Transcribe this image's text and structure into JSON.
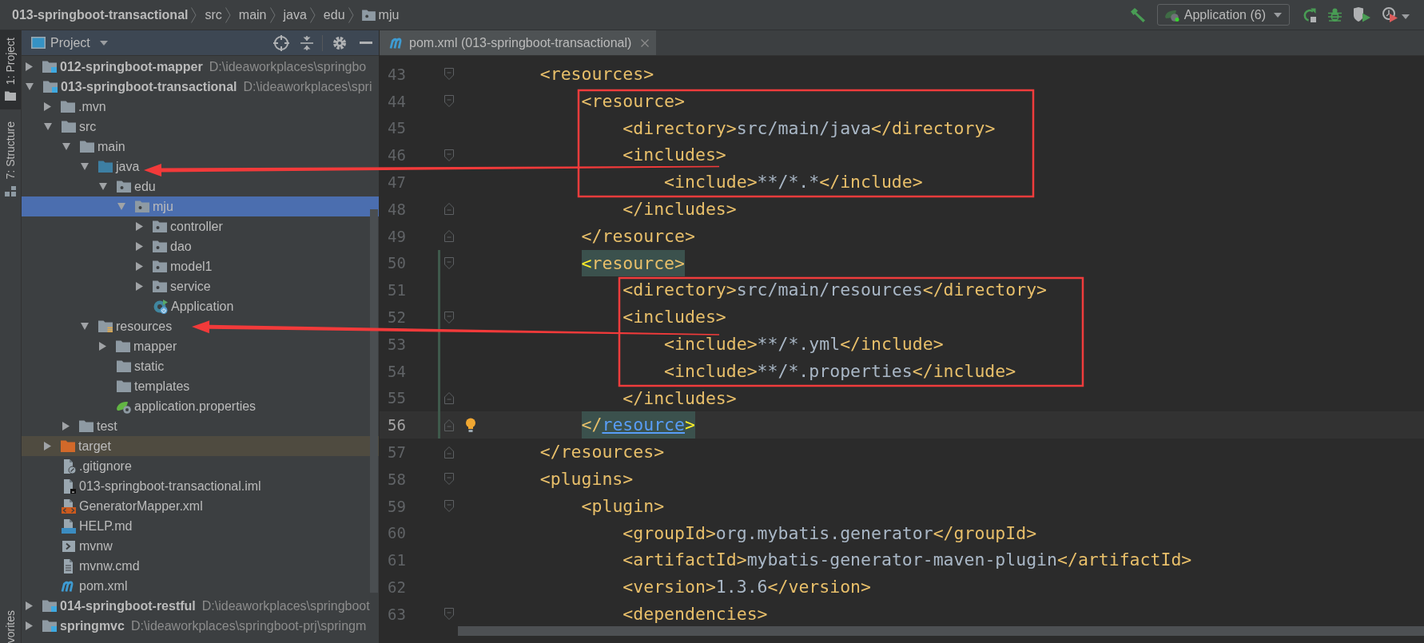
{
  "breadcrumbs": [
    {
      "label": "013-springboot-transactional",
      "kind": "module"
    },
    {
      "label": "src",
      "kind": "folder"
    },
    {
      "label": "main",
      "kind": "folder"
    },
    {
      "label": "java",
      "kind": "folder"
    },
    {
      "label": "edu",
      "kind": "folder"
    },
    {
      "label": "mju",
      "kind": "package"
    }
  ],
  "toolbar": {
    "run_config": "Application (6)"
  },
  "tool_strip": [
    {
      "label": "1: Project",
      "kind": "project",
      "selected": true
    },
    {
      "label": "7: Structure",
      "kind": "structure",
      "selected": false
    },
    {
      "label": "vorites",
      "kind": "favorites",
      "selected": false
    }
  ],
  "project_panel": {
    "title": "Project",
    "tree": [
      {
        "label": "012-springboot-mapper",
        "path": "D:\\ideaworkplaces\\springbo",
        "kind": "module",
        "expandable": true,
        "expanded": false,
        "selected": false
      },
      {
        "label": "013-springboot-transactional",
        "path": "D:\\ideaworkplaces\\spri",
        "kind": "module",
        "expandable": true,
        "expanded": true,
        "selected": false,
        "children": [
          {
            "label": ".mvn",
            "kind": "folder",
            "expandable": true,
            "expanded": false,
            "selected": false
          },
          {
            "label": "src",
            "kind": "folder",
            "expandable": true,
            "expanded": true,
            "selected": false,
            "children": [
              {
                "label": "main",
                "kind": "folder",
                "expandable": true,
                "expanded": true,
                "selected": false,
                "children": [
                  {
                    "label": "java",
                    "kind": "source-root",
                    "expandable": true,
                    "expanded": true,
                    "selected": false,
                    "children": [
                      {
                        "label": "edu",
                        "kind": "package",
                        "expandable": true,
                        "expanded": true,
                        "selected": false,
                        "children": [
                          {
                            "label": "mju",
                            "kind": "package",
                            "expandable": true,
                            "expanded": true,
                            "selected": true,
                            "children": [
                              {
                                "label": "controller",
                                "kind": "package",
                                "expandable": true,
                                "expanded": false,
                                "selected": false
                              },
                              {
                                "label": "dao",
                                "kind": "package",
                                "expandable": true,
                                "expanded": false,
                                "selected": false
                              },
                              {
                                "label": "model1",
                                "kind": "package",
                                "expandable": true,
                                "expanded": false,
                                "selected": false
                              },
                              {
                                "label": "service",
                                "kind": "package",
                                "expandable": true,
                                "expanded": false,
                                "selected": false
                              },
                              {
                                "label": "Application",
                                "kind": "spring-class",
                                "expandable": false,
                                "selected": false
                              }
                            ]
                          }
                        ]
                      }
                    ]
                  },
                  {
                    "label": "resources",
                    "kind": "resources-root",
                    "expandable": true,
                    "expanded": true,
                    "selected": false,
                    "children": [
                      {
                        "label": "mapper",
                        "kind": "folder",
                        "expandable": true,
                        "expanded": false,
                        "selected": false
                      },
                      {
                        "label": "static",
                        "kind": "folder",
                        "expandable": false,
                        "selected": false
                      },
                      {
                        "label": "templates",
                        "kind": "folder",
                        "expandable": false,
                        "selected": false
                      },
                      {
                        "label": "application.properties",
                        "kind": "spring-config",
                        "expandable": false,
                        "selected": false
                      }
                    ]
                  }
                ]
              },
              {
                "label": "test",
                "kind": "folder",
                "expandable": true,
                "expanded": false,
                "selected": false
              }
            ]
          },
          {
            "label": "target",
            "kind": "excluded",
            "expandable": true,
            "expanded": false,
            "selected": false
          },
          {
            "label": ".gitignore",
            "kind": "ignore-file",
            "expandable": false,
            "selected": false
          },
          {
            "label": "013-springboot-transactional.iml",
            "kind": "module-file",
            "expandable": false,
            "selected": false
          },
          {
            "label": "GeneratorMapper.xml",
            "kind": "xml-file",
            "expandable": false,
            "selected": false
          },
          {
            "label": "HELP.md",
            "kind": "markdown-file",
            "expandable": false,
            "selected": false
          },
          {
            "label": "mvnw",
            "kind": "shell-file",
            "expandable": false,
            "selected": false
          },
          {
            "label": "mvnw.cmd",
            "kind": "text-file",
            "expandable": false,
            "selected": false
          },
          {
            "label": "pom.xml",
            "kind": "maven-file",
            "expandable": false,
            "selected": false
          }
        ]
      },
      {
        "label": "014-springboot-restful",
        "path": "D:\\ideaworkplaces\\springboot",
        "kind": "module",
        "expandable": true,
        "expanded": false,
        "selected": false
      },
      {
        "label": "springmvc",
        "path": "D:\\ideaworkplaces\\springboot-prj\\springm",
        "kind": "module",
        "expandable": true,
        "expanded": false,
        "selected": false
      }
    ]
  },
  "editor": {
    "tabs": [
      {
        "label": "pom.xml (013-springboot-transactional)",
        "selected": true
      }
    ],
    "lines": [
      {
        "number": "43",
        "tokens": [
          {
            "kind": "tag",
            "text": "<resources>"
          }
        ],
        "fold_start": true,
        "fold_end": false,
        "current": false,
        "changed": false,
        "matched": false
      },
      {
        "number": "44",
        "tokens": [
          {
            "kind": "tag",
            "text": "<resource>"
          }
        ],
        "fold_start": true,
        "fold_end": false,
        "current": false,
        "changed": false,
        "matched": false
      },
      {
        "number": "45",
        "tokens": [
          {
            "kind": "tag",
            "text": "<directory>"
          },
          {
            "kind": "text",
            "text": "src/main/java"
          },
          {
            "kind": "tag",
            "text": "</directory>"
          }
        ],
        "fold_start": false,
        "fold_end": false,
        "current": false,
        "changed": false,
        "matched": false
      },
      {
        "number": "46",
        "tokens": [
          {
            "kind": "tag",
            "text": "<includes>"
          }
        ],
        "fold_start": true,
        "fold_end": false,
        "current": false,
        "changed": false,
        "matched": false
      },
      {
        "number": "47",
        "tokens": [
          {
            "kind": "tag",
            "text": "<include>"
          },
          {
            "kind": "text",
            "text": "**/*.*"
          },
          {
            "kind": "tag",
            "text": "</include>"
          }
        ],
        "fold_start": false,
        "fold_end": false,
        "current": false,
        "changed": false,
        "matched": false
      },
      {
        "number": "48",
        "tokens": [
          {
            "kind": "tag",
            "text": "</includes>"
          }
        ],
        "fold_start": false,
        "fold_end": true,
        "current": false,
        "changed": false,
        "matched": false
      },
      {
        "number": "49",
        "tokens": [
          {
            "kind": "tag",
            "text": "</resource>"
          }
        ],
        "fold_start": false,
        "fold_end": true,
        "current": false,
        "changed": false,
        "matched": false
      },
      {
        "number": "50",
        "tokens": [
          {
            "kind": "brace",
            "text": "<"
          },
          {
            "kind": "tag",
            "text": "resource>"
          }
        ],
        "fold_start": true,
        "fold_end": false,
        "current": false,
        "changed": true,
        "matched": true
      },
      {
        "number": "51",
        "tokens": [
          {
            "kind": "tag",
            "text": "<directory>"
          },
          {
            "kind": "text",
            "text": "src/main/resources"
          },
          {
            "kind": "tag",
            "text": "</directory>"
          }
        ],
        "fold_start": false,
        "fold_end": false,
        "current": false,
        "changed": true,
        "matched": false
      },
      {
        "number": "52",
        "tokens": [
          {
            "kind": "tag",
            "text": "<includes>"
          }
        ],
        "fold_start": true,
        "fold_end": false,
        "current": false,
        "changed": true,
        "matched": false
      },
      {
        "number": "53",
        "tokens": [
          {
            "kind": "tag",
            "text": "<include>"
          },
          {
            "kind": "text",
            "text": "**/*.yml"
          },
          {
            "kind": "tag",
            "text": "</include>"
          }
        ],
        "fold_start": false,
        "fold_end": false,
        "current": false,
        "changed": true,
        "matched": false
      },
      {
        "number": "54",
        "tokens": [
          {
            "kind": "tag",
            "text": "<include>"
          },
          {
            "kind": "text",
            "text": "**/*.properties"
          },
          {
            "kind": "tag",
            "text": "</include>"
          }
        ],
        "fold_start": false,
        "fold_end": false,
        "current": false,
        "changed": true,
        "matched": false
      },
      {
        "number": "55",
        "tokens": [
          {
            "kind": "tag",
            "text": "</includes>"
          }
        ],
        "fold_start": false,
        "fold_end": true,
        "current": false,
        "changed": true,
        "matched": false
      },
      {
        "number": "56",
        "tokens": [
          {
            "kind": "tag",
            "text": "</"
          },
          {
            "kind": "link",
            "text": "resource"
          },
          {
            "kind": "brace",
            "text": ">"
          }
        ],
        "fold_start": false,
        "fold_end": true,
        "current": true,
        "changed": true,
        "matched": true
      },
      {
        "number": "57",
        "tokens": [
          {
            "kind": "tag",
            "text": "</resources>"
          }
        ],
        "fold_start": false,
        "fold_end": true,
        "current": false,
        "changed": false,
        "matched": false
      },
      {
        "number": "58",
        "tokens": [
          {
            "kind": "tag",
            "text": "<plugins>"
          }
        ],
        "fold_start": true,
        "fold_end": false,
        "current": false,
        "changed": false,
        "matched": false
      },
      {
        "number": "59",
        "tokens": [
          {
            "kind": "tag",
            "text": "<plugin>"
          }
        ],
        "fold_start": true,
        "fold_end": false,
        "current": false,
        "changed": false,
        "matched": false
      },
      {
        "number": "60",
        "tokens": [
          {
            "kind": "tag",
            "text": "<groupId>"
          },
          {
            "kind": "text",
            "text": "org.mybatis.generator"
          },
          {
            "kind": "tag",
            "text": "</groupId>"
          }
        ],
        "fold_start": false,
        "fold_end": false,
        "current": false,
        "changed": false,
        "matched": false
      },
      {
        "number": "61",
        "tokens": [
          {
            "kind": "tag",
            "text": "<artifactId>"
          },
          {
            "kind": "text",
            "text": "mybatis-generator-maven-plugin"
          },
          {
            "kind": "tag",
            "text": "</artifactId>"
          }
        ],
        "fold_start": false,
        "fold_end": false,
        "current": false,
        "changed": false,
        "matched": false
      },
      {
        "number": "62",
        "tokens": [
          {
            "kind": "tag",
            "text": "<version>"
          },
          {
            "kind": "text",
            "text": "1.3.6"
          },
          {
            "kind": "tag",
            "text": "</version>"
          }
        ],
        "fold_start": false,
        "fold_end": false,
        "current": false,
        "changed": false,
        "matched": false
      },
      {
        "number": "63",
        "tokens": [
          {
            "kind": "tag",
            "text": "<dependencies>"
          }
        ],
        "fold_start": true,
        "fold_end": false,
        "current": false,
        "changed": false,
        "matched": false
      }
    ]
  }
}
